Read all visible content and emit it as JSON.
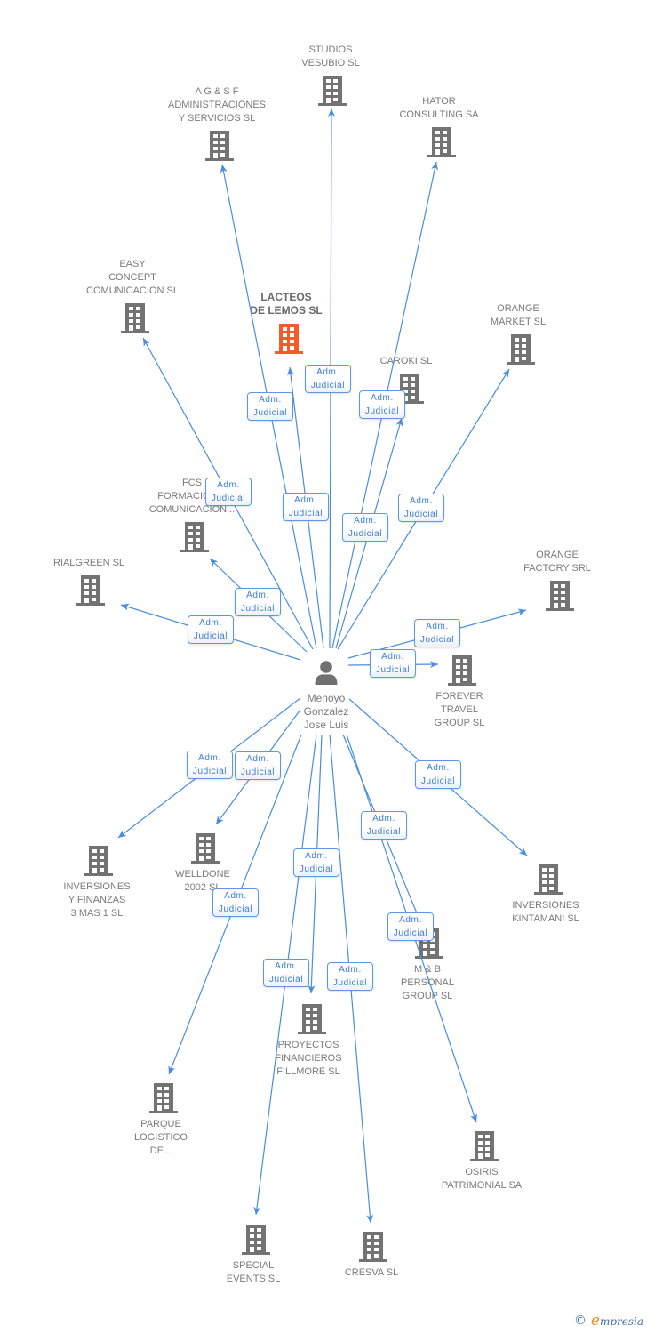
{
  "center": {
    "name_lines": [
      "Menoyo",
      "Gonzalez",
      "Jose Luis"
    ],
    "icon": "person-icon"
  },
  "nodes": [
    {
      "id": "studios-vesubio",
      "label_lines": [
        "STUDIOS",
        "VESUBIO SL"
      ],
      "relation_lines": [
        "Adm.",
        "Judicial"
      ],
      "icon": "building-icon",
      "highlighted": false
    },
    {
      "id": "agsf",
      "label_lines": [
        "A G & S F",
        "ADMINISTRACIONES",
        "Y SERVICIOS SL"
      ],
      "relation_lines": [
        "Adm.",
        "Judicial"
      ],
      "icon": "building-icon",
      "highlighted": false
    },
    {
      "id": "hator",
      "label_lines": [
        "HATOR",
        "CONSULTING SA"
      ],
      "relation_lines": [
        "Adm.",
        "Judicial"
      ],
      "icon": "building-icon",
      "highlighted": false
    },
    {
      "id": "easy-concept",
      "label_lines": [
        "EASY",
        "CONCEPT",
        "COMUNICACION SL"
      ],
      "relation_lines": [
        "Adm.",
        "Judicial"
      ],
      "icon": "building-icon",
      "highlighted": false
    },
    {
      "id": "lacteos",
      "label_lines": [
        "LACTEOS",
        "DE LEMOS SL"
      ],
      "relation_lines": [
        "Adm.",
        "Judicial"
      ],
      "icon": "building-icon",
      "highlighted": true
    },
    {
      "id": "caroki",
      "label_lines": [
        "CAROKI SL"
      ],
      "relation_lines": [
        "Adm.",
        "Judicial"
      ],
      "icon": "building-icon",
      "highlighted": false
    },
    {
      "id": "orange-market",
      "label_lines": [
        "ORANGE",
        "MARKET SL"
      ],
      "relation_lines": [
        "Adm.",
        "Judicial"
      ],
      "icon": "building-icon",
      "highlighted": false
    },
    {
      "id": "fcs",
      "label_lines": [
        "FCS",
        "FORMACION Y",
        "COMUNICACION..."
      ],
      "relation_lines": [
        "Adm.",
        "Judicial"
      ],
      "icon": "building-icon",
      "highlighted": false
    },
    {
      "id": "rialgreen",
      "label_lines": [
        "RIALGREEN SL"
      ],
      "relation_lines": [
        "Adm.",
        "Judicial"
      ],
      "icon": "building-icon",
      "highlighted": false
    },
    {
      "id": "orange-factory",
      "label_lines": [
        "ORANGE",
        "FACTORY SRL"
      ],
      "relation_lines": [
        "Adm.",
        "Judicial"
      ],
      "icon": "building-icon",
      "highlighted": false
    },
    {
      "id": "forever-travel",
      "label_lines": [
        "FOREVER",
        "TRAVEL",
        "GROUP SL"
      ],
      "relation_lines": [
        "Adm.",
        "Judicial"
      ],
      "icon": "building-icon",
      "highlighted": false
    },
    {
      "id": "inversiones-finanzas",
      "label_lines": [
        "INVERSIONES",
        "Y FINANZAS",
        "3 MAS 1 SL"
      ],
      "relation_lines": [
        "Adm.",
        "Judicial"
      ],
      "icon": "building-icon",
      "highlighted": false
    },
    {
      "id": "welldone",
      "label_lines": [
        "WELLDONE",
        "2002 SL"
      ],
      "relation_lines": [
        "Adm.",
        "Judicial"
      ],
      "icon": "building-icon",
      "highlighted": false
    },
    {
      "id": "kintamani",
      "label_lines": [
        "INVERSIONES",
        "KINTAMANI SL"
      ],
      "relation_lines": [
        "Adm.",
        "Judicial"
      ],
      "icon": "building-icon",
      "highlighted": false
    },
    {
      "id": "mb-personal",
      "label_lines": [
        "M & B",
        "PERSONAL",
        "GROUP SL"
      ],
      "relation_lines": [
        "Adm.",
        "Judicial"
      ],
      "icon": "building-icon",
      "highlighted": false
    },
    {
      "id": "proyectos-fillmore",
      "label_lines": [
        "PROYECTOS",
        "FINANCIEROS",
        "FILLMORE SL"
      ],
      "relation_lines": [
        "Adm.",
        "Judicial"
      ],
      "icon": "building-icon",
      "highlighted": false
    },
    {
      "id": "parque-logistico",
      "label_lines": [
        "PARQUE",
        "LOGISTICO",
        "DE..."
      ],
      "relation_lines": [
        "Adm.",
        "Judicial"
      ],
      "icon": "building-icon",
      "highlighted": false
    },
    {
      "id": "osiris",
      "label_lines": [
        "OSIRIS",
        "PATRIMONIAL SA"
      ],
      "relation_lines": [
        "Adm.",
        "Judicial"
      ],
      "icon": "building-icon",
      "highlighted": false
    },
    {
      "id": "special-events",
      "label_lines": [
        "SPECIAL",
        "EVENTS SL"
      ],
      "relation_lines": [
        "Adm.",
        "Judicial"
      ],
      "icon": "building-icon",
      "highlighted": false
    },
    {
      "id": "cresva",
      "label_lines": [
        "CRESVA SL"
      ],
      "relation_lines": [
        "Adm.",
        "Judicial"
      ],
      "icon": "building-icon",
      "highlighted": false
    }
  ],
  "colors": {
    "edge": "#4a8ddc",
    "node_icon": "#737373",
    "highlight": "#f95a2c",
    "badge_text": "#3b7dd8"
  },
  "footer": {
    "copyright_symbol": "©",
    "brand_first_letter": "e",
    "brand_rest": "mpresia"
  }
}
